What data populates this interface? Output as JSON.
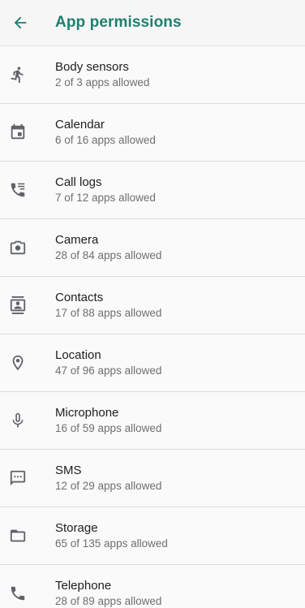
{
  "header": {
    "title": "App permissions",
    "back_icon": "arrow-back-icon"
  },
  "colors": {
    "accent": "#1f7f70",
    "icon": "#5f6368",
    "primary_text": "#202020",
    "secondary_text": "#6f6f6f"
  },
  "permissions": [
    {
      "label": "Body sensors",
      "summary": "2 of 3 apps allowed",
      "icon": "body-sensors-icon"
    },
    {
      "label": "Calendar",
      "summary": "6 of 16 apps allowed",
      "icon": "calendar-icon"
    },
    {
      "label": "Call logs",
      "summary": "7 of 12 apps allowed",
      "icon": "call-logs-icon"
    },
    {
      "label": "Camera",
      "summary": "28 of 84 apps allowed",
      "icon": "camera-icon"
    },
    {
      "label": "Contacts",
      "summary": "17 of 88 apps allowed",
      "icon": "contacts-icon"
    },
    {
      "label": "Location",
      "summary": "47 of 96 apps allowed",
      "icon": "location-icon"
    },
    {
      "label": "Microphone",
      "summary": "16 of 59 apps allowed",
      "icon": "microphone-icon"
    },
    {
      "label": "SMS",
      "summary": "12 of 29 apps allowed",
      "icon": "sms-icon"
    },
    {
      "label": "Storage",
      "summary": "65 of 135 apps allowed",
      "icon": "storage-icon"
    },
    {
      "label": "Telephone",
      "summary": "28 of 89 apps allowed",
      "icon": "telephone-icon"
    }
  ]
}
